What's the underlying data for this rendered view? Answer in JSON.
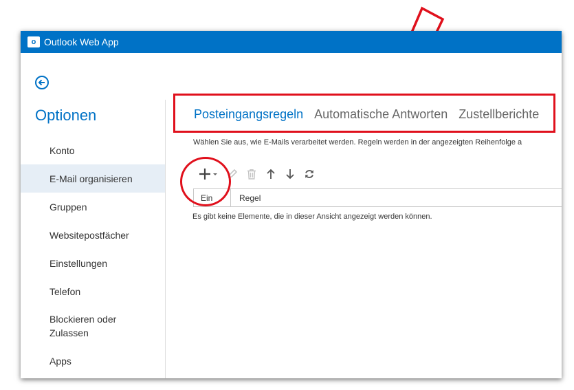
{
  "app": {
    "logo_letter": "o",
    "title": "Outlook Web App"
  },
  "options_title": "Optionen",
  "sidebar": {
    "items": [
      {
        "label": "Konto",
        "active": false
      },
      {
        "label": "E-Mail organisieren",
        "active": true
      },
      {
        "label": "Gruppen",
        "active": false
      },
      {
        "label": "Websitepostfächer",
        "active": false
      },
      {
        "label": "Einstellungen",
        "active": false
      },
      {
        "label": "Telefon",
        "active": false
      },
      {
        "label": "Blockieren oder Zulassen",
        "active": false
      },
      {
        "label": "Apps",
        "active": false
      }
    ]
  },
  "tabs": [
    {
      "label": "Posteingangsregeln",
      "active": true
    },
    {
      "label": "Automatische Antworten",
      "active": false
    },
    {
      "label": "Zustellberichte",
      "active": false
    }
  ],
  "description": "Wählen Sie aus, wie E-Mails verarbeitet werden. Regeln werden in der angezeigten Reihenfolge a",
  "toolbar": {
    "icons": [
      "add-icon",
      "edit-icon",
      "delete-icon",
      "move-up-icon",
      "move-down-icon",
      "refresh-icon"
    ]
  },
  "table": {
    "columns": [
      "Ein",
      "Regel"
    ],
    "empty_message": "Es gibt keine Elemente, die in dieser Ansicht angezeigt werden können."
  },
  "colors": {
    "brand": "#0072c6",
    "annotation": "#e0101c",
    "active_nav": "#e6eef6"
  }
}
